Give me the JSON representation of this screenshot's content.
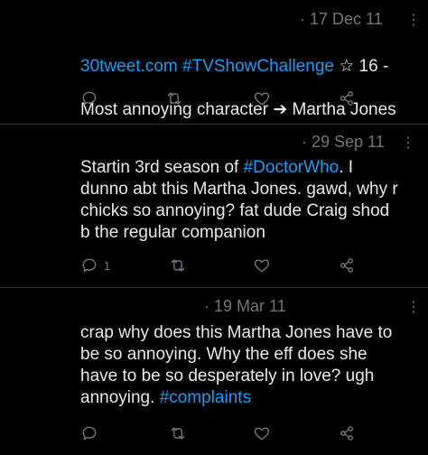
{
  "tweets": [
    {
      "date": "· 17 Dec 11",
      "link": "30tweet.com",
      "hashtag": "#TVShowChallenge",
      "rest_line1": " ☆ 16 -",
      "line2": "Most annoying character ➔ Martha Jones",
      "reply_count": "",
      "icons": [
        "reply-icon",
        "retweet-icon",
        "like-icon",
        "share-icon"
      ]
    },
    {
      "date": "· 29 Sep 11",
      "pre": "Startin 3rd season of ",
      "hashtag": "#DoctorWho",
      "post": ". I\ndunno abt this Martha Jones. gawd, why r\nchicks so annoying? fat dude Craig shod\nb the regular companion",
      "reply_count": "1"
    },
    {
      "date": "· 19 Mar 11",
      "pre": "crap why does this Martha Jones have to\nbe so annoying. Why the eff does she\nhave to be so desperately in love? ugh\nannoying. ",
      "hashtag": "#complaints",
      "reply_count": ""
    }
  ],
  "more_glyph": "⋮",
  "colors": {
    "background": "#000000",
    "text": "#e7e9ea",
    "muted": "#71767b",
    "accent": "#1d9bf0",
    "divider": "#2f3336"
  }
}
